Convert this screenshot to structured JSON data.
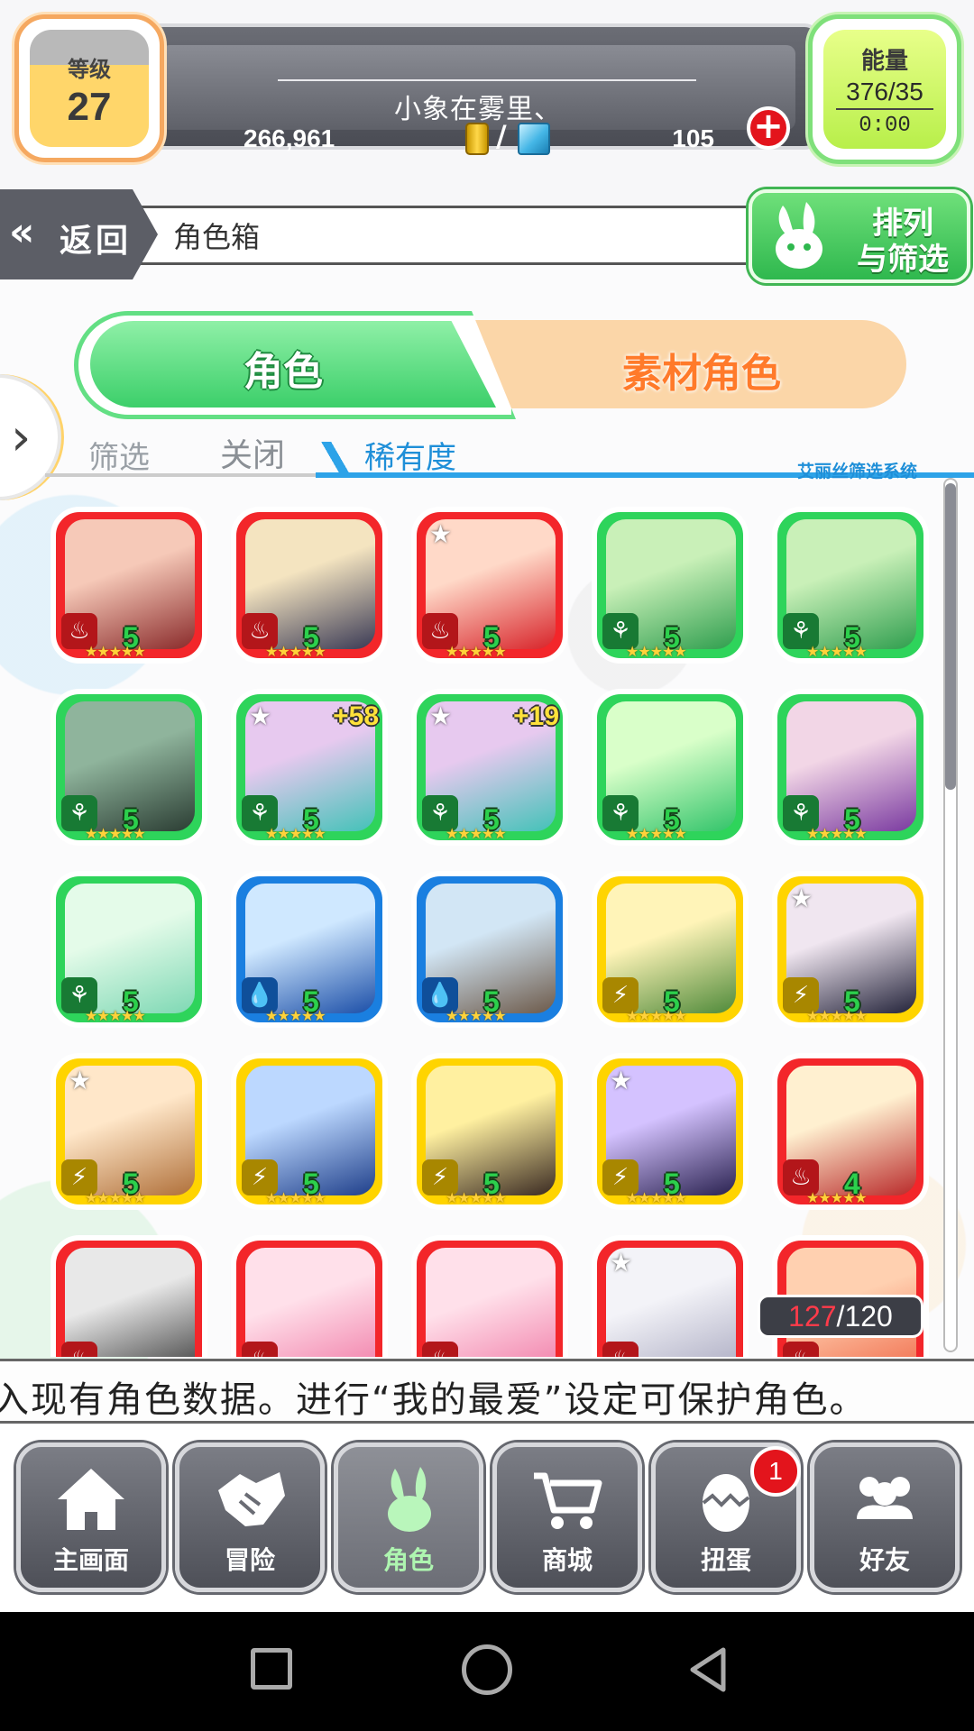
{
  "hud": {
    "level_label": "等级",
    "level_value": "27",
    "player_name": "小象在雾里、",
    "coins": "266,961",
    "gems": "105",
    "energy_label": "能量",
    "energy_value": "376/35",
    "energy_timer": "0:00"
  },
  "nav": {
    "back_label": "返回",
    "page_title": "角色箱",
    "sort_label_line1": "排列",
    "sort_label_line2": "与筛选"
  },
  "tabs": {
    "primary": "角色",
    "secondary": "素材角色"
  },
  "filter": {
    "label": "筛选",
    "state": "关闭",
    "sort_key": "稀有度",
    "system_name": "艾丽丝筛选系统"
  },
  "grid": {
    "stars": "★★★★★",
    "cards": [
      {
        "attr": "fire",
        "rank": "5",
        "plus": "",
        "fav": false,
        "portrait": [
          "#f6c9b8",
          "#8a2b2b"
        ]
      },
      {
        "attr": "fire",
        "rank": "5",
        "plus": "",
        "fav": false,
        "portrait": [
          "#f4e4c0",
          "#3a3a55"
        ]
      },
      {
        "attr": "fire",
        "rank": "5",
        "plus": "",
        "fav": true,
        "portrait": [
          "#ffd9c8",
          "#d8242a"
        ]
      },
      {
        "attr": "wood",
        "rank": "5",
        "plus": "",
        "fav": false,
        "portrait": [
          "#c9f0b8",
          "#2f9e4e"
        ]
      },
      {
        "attr": "wood",
        "rank": "5",
        "plus": "",
        "fav": false,
        "portrait": [
          "#c9f0b8",
          "#2f9e4e"
        ]
      },
      {
        "attr": "wood",
        "rank": "5",
        "plus": "",
        "fav": false,
        "portrait": [
          "#8fb49c",
          "#2b3d33"
        ]
      },
      {
        "attr": "wood",
        "rank": "5",
        "plus": "+58",
        "fav": true,
        "portrait": [
          "#e7c9ef",
          "#43c2b8"
        ]
      },
      {
        "attr": "wood",
        "rank": "5",
        "plus": "+19",
        "fav": true,
        "portrait": [
          "#e7c9ef",
          "#43c2b8"
        ]
      },
      {
        "attr": "wood",
        "rank": "5",
        "plus": "",
        "fav": false,
        "portrait": [
          "#d9ffc9",
          "#32c46a"
        ]
      },
      {
        "attr": "wood",
        "rank": "5",
        "plus": "",
        "fav": false,
        "portrait": [
          "#f2d6e6",
          "#7a3aa0"
        ]
      },
      {
        "attr": "wood",
        "rank": "5",
        "plus": "",
        "fav": false,
        "portrait": [
          "#e4fbe9",
          "#7ed8b4"
        ]
      },
      {
        "attr": "water",
        "rank": "5",
        "plus": "",
        "fav": false,
        "portrait": [
          "#cfe8ff",
          "#1c4fa8"
        ]
      },
      {
        "attr": "water",
        "rank": "5",
        "plus": "",
        "fav": false,
        "portrait": [
          "#d2e6f5",
          "#6d5a4a"
        ]
      },
      {
        "attr": "thunder",
        "rank": "5",
        "plus": "",
        "fav": false,
        "portrait": [
          "#fff4b8",
          "#4f8a3a"
        ]
      },
      {
        "attr": "thunder",
        "rank": "5",
        "plus": "",
        "fav": true,
        "portrait": [
          "#f0e6f0",
          "#23233a"
        ]
      },
      {
        "attr": "thunder",
        "rank": "5",
        "plus": "",
        "fav": true,
        "portrait": [
          "#ffe7c9",
          "#b0703a"
        ]
      },
      {
        "attr": "thunder",
        "rank": "5",
        "plus": "",
        "fav": false,
        "portrait": [
          "#bcd8ff",
          "#1f3f8a"
        ]
      },
      {
        "attr": "thunder",
        "rank": "5",
        "plus": "",
        "fav": false,
        "portrait": [
          "#fff0a0",
          "#3a2a22"
        ]
      },
      {
        "attr": "thunder",
        "rank": "5",
        "plus": "",
        "fav": true,
        "portrait": [
          "#d4c2ff",
          "#2a2250"
        ]
      },
      {
        "attr": "fire",
        "rank": "4",
        "plus": "",
        "fav": false,
        "portrait": [
          "#fff0d0",
          "#b92a2a"
        ]
      },
      {
        "attr": "fire",
        "rank": "",
        "plus": "",
        "fav": false,
        "portrait": [
          "#e8e8e8",
          "#3a3a3a"
        ]
      },
      {
        "attr": "fire",
        "rank": "",
        "plus": "",
        "fav": false,
        "portrait": [
          "#ffe0ea",
          "#f07aa6"
        ]
      },
      {
        "attr": "fire",
        "rank": "",
        "plus": "",
        "fav": false,
        "portrait": [
          "#ffe0ea",
          "#f07aa6"
        ]
      },
      {
        "attr": "fire",
        "rank": "",
        "plus": "",
        "fav": true,
        "portrait": [
          "#f3f3f8",
          "#a9a9c0"
        ]
      },
      {
        "attr": "fire",
        "rank": "",
        "plus": "",
        "fav": false,
        "portrait": [
          "#ffd0b0",
          "#f06a4a"
        ]
      }
    ]
  },
  "count": {
    "current": "127",
    "max": "/120"
  },
  "message": "入现有角色数据。进行“我的最爱”设定可保护角色。",
  "bottom_nav": {
    "items": [
      {
        "label": "主画面",
        "icon": "home-icon"
      },
      {
        "label": "冒险",
        "icon": "handshake-icon"
      },
      {
        "label": "角色",
        "icon": "bunny-icon"
      },
      {
        "label": "商城",
        "icon": "cart-icon"
      },
      {
        "label": "扭蛋",
        "icon": "egg-icon"
      },
      {
        "label": "好友",
        "icon": "friends-icon"
      }
    ],
    "gacha_badge": "1"
  },
  "colors": {
    "fire": "#f3262a",
    "wood": "#2ed45b",
    "water": "#1a7fe0",
    "thunder": "#ffd400",
    "accent_green": "#3ccf6a",
    "accent_orange": "#ff7a2a"
  }
}
